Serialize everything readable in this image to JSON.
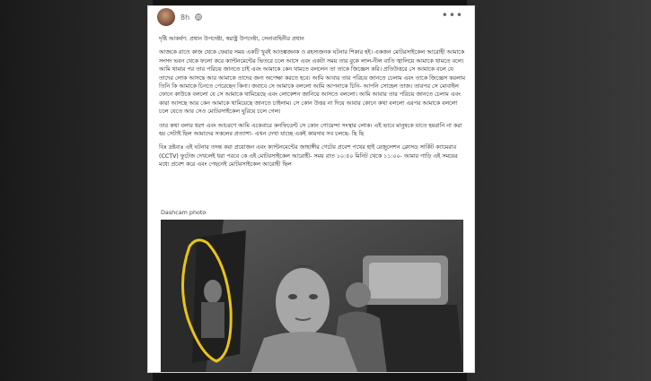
{
  "post": {
    "timestamp": "8h",
    "title": "দৃষ্টি আকর্ষণ: প্রধান উপদেষ্টা, স্বরাষ্ট্র উপদেষ্টা, সেনাবাহিনীর প্রধান",
    "paragraphs": [
      "আজকে রাতে কাজ থেকে ফেরার সময় একটি খুবই আতঙ্কজনক ও রহস্যজনক ঘটনার শিকার হই। একজন মোটরসাইকেল আরোহী আমাকে সংসদ ভবন থেকে ফলো করে ক্যান্টনমেন্টের ভিতরে চলে আসে এবং একটা সময় তার বুকে লাল-নীল বাতি জ্বালিয়ে আমাকে থামতে বলে। আমি থামার পর তার পরিচয় জানতে চাই এবং আমাকে কেন থামতে বললেন তা তাকে জিজ্ঞেস করি। প্রতিউত্তরে সে আমাকে বলে যে তাদের লোক আসছে আর আমাকে তাদের জন্য অপেক্ষা করতে হবে। আমি আবার তার পরিচয় জানতে চেলাম এবং তাকে জিজ্ঞেস করলাম তিনি কি আমাকে চিনতে পেরেছেন কিনা। জবাবে সে আমাকে বললো আমি আপনাকে চিনি- আপনি সোহেল তাজ। তারপর সে মোবাইল ফোনে কাউকে বললো যে সে আমাকে থামিয়েছে এবং লোকেশন জানিয়ে আসতে বললো। আমি আবার তার পরিচয় জানতে চেলাম এবং কারা আসছে আর কেন আমাকে থামিয়েছে জানতে চাইলাম। সে কোন উত্তর না দিয়ে আবার কোনে কথা বললো এরপর আমাকে বললো চলে যেতে আর সেও মোটরসাইকেল ঘুরিয়ে চলে গেল।",
      "তার কথা বলার ধরণ এবং আচরণে আমি একেবারে কনফিডেন্ট সে কোন গোয়েন্দা সংস্থার লোক। এই ভাবে মানুষকে যাতে হয়রানি না করা হয় সেটাই ছিল আমাদের সকলের প্রত্যাশা- এখন দেখা যাচ্ছে একই কায়দায় সব চলছে- ছি ছি",
      "বিঃ দ্রষ্টব্যঃ এই ঘটনার তদন্ত করা প্রয়োজন এবং ক্যান্টনমেন্টের জাহাঙ্গীর গেটের প্রবেশ পথের হাই রেজুলেশন ক্লোসড সার্কিট ক্যামেরার (CCTV) ফুটেজ দেখলেই ধরা পরবে কে এই মোটরসাইকেল আরোহী- সময় রাত ১০:৫০ মিনিট থেকে ১১:০০- আমার গাড়ি এই সময়ের মধ্যে প্রবেশ করে এবং পেছনেই মোটরসাইকেল আরোহী ছিল"
    ],
    "photo_caption": "Dashcam photo"
  },
  "colors": {
    "card": "#ffffff",
    "text": "#1c1e21",
    "meta": "#65676b",
    "annotation": "#e8c31a"
  },
  "icons": {
    "privacy": "globe-icon",
    "more": "more-options-icon"
  }
}
